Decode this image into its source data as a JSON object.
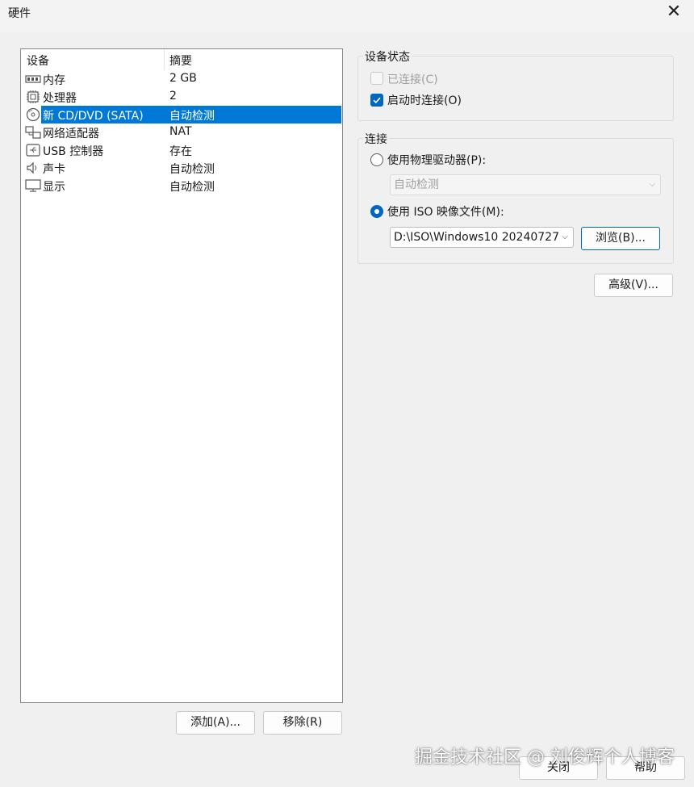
{
  "window": {
    "title": "硬件",
    "close_glyph": "✕"
  },
  "device_list": {
    "col_device": "设备",
    "col_summary": "摘要",
    "rows": [
      {
        "icon": "memory-icon",
        "name": "内存",
        "summary": "2 GB"
      },
      {
        "icon": "processor-icon",
        "name": "处理器",
        "summary": "2"
      },
      {
        "icon": "cd-dvd-icon",
        "name": "新 CD/DVD (SATA)",
        "summary": "自动检测",
        "selected": true
      },
      {
        "icon": "network-adapter-icon",
        "name": "网络适配器",
        "summary": "NAT"
      },
      {
        "icon": "usb-controller-icon",
        "name": "USB 控制器",
        "summary": "存在"
      },
      {
        "icon": "sound-card-icon",
        "name": "声卡",
        "summary": "自动检测"
      },
      {
        "icon": "display-icon",
        "name": "显示",
        "summary": "自动检测"
      }
    ]
  },
  "list_buttons": {
    "add": "添加(A)...",
    "remove": "移除(R)"
  },
  "device_status": {
    "title": "设备状态",
    "connected_label": "已连接(C)",
    "connected_checked": false,
    "connected_disabled": true,
    "connect_at_power_on_label": "启动时连接(O)",
    "connect_at_power_on_checked": true
  },
  "connection": {
    "title": "连接",
    "physical_drive_label": "使用物理驱动器(P):",
    "physical_drive_value": "自动检测",
    "iso_label": "使用 ISO 映像文件(M):",
    "iso_path": "D:\\ISO\\Windows10 20240727.",
    "browse": "浏览(B)...",
    "selected": "iso"
  },
  "advanced_button": "高级(V)...",
  "footer": {
    "close": "关闭",
    "help": "帮助"
  },
  "watermark": "掘金技术社区 @ 刘俊辉个人博客",
  "colors": {
    "accent": "#0067c0",
    "selection": "#0078d7"
  }
}
